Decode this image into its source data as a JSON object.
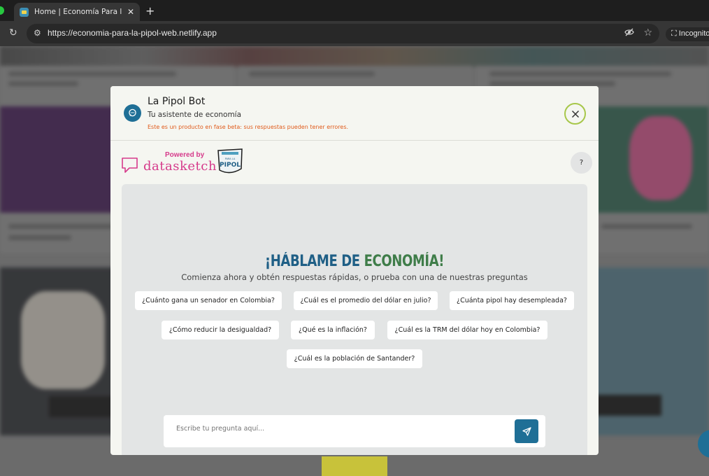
{
  "browser": {
    "tab_title": "Home | Economía Para la Pipol",
    "tab_close": "✕",
    "new_tab": "+",
    "url": "https://economia-para-la-pipol-web.netlify.app",
    "incognito_label": "Incognito"
  },
  "modal": {
    "title": "La Pipol Bot",
    "subtitle": "Tu asistente de economía",
    "warning": "Este es un producto en fase beta: sus respuestas pueden tener errores.",
    "powered_by": "Powered by",
    "brand": "datasketch",
    "pipol_logo_text": "PIPOL",
    "help_label": "?",
    "headline_part1": "¡HÁBLAME DE ",
    "headline_part2": "ECONOMÍA!",
    "subheadline": "Comienza ahora y obtén respuestas rápidas, o prueba con una de nuestras preguntas",
    "suggestions": [
      "¿Cuánto gana un senador en Colombia?",
      "¿Cuál es el promedio del dólar en julio?",
      "¿Cuánta pipol hay desempleada?",
      "¿Cómo reducir la desigualdad?",
      "¿Qué es la inflación?",
      "¿Cuál es la TRM del dólar hoy en Colombia?",
      "¿Cuál es la población de Santander?"
    ],
    "input_placeholder": "Escribe tu pregunta aquí..."
  },
  "colors": {
    "accent_blue": "#1f6f96",
    "accent_pink": "#d63a8b",
    "accent_green": "#3f7d49",
    "warning_orange": "#e05a1a",
    "close_ring": "#a7c74a"
  }
}
